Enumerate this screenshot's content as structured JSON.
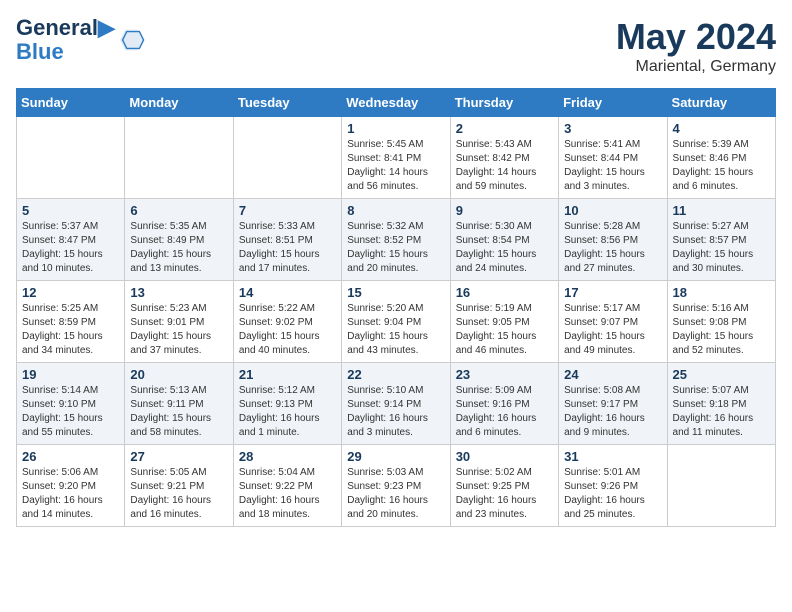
{
  "header": {
    "logo_line1": "General",
    "logo_line2": "Blue",
    "month": "May 2024",
    "location": "Mariental, Germany"
  },
  "columns": [
    "Sunday",
    "Monday",
    "Tuesday",
    "Wednesday",
    "Thursday",
    "Friday",
    "Saturday"
  ],
  "weeks": [
    [
      {
        "day": "",
        "info": ""
      },
      {
        "day": "",
        "info": ""
      },
      {
        "day": "",
        "info": ""
      },
      {
        "day": "1",
        "info": "Sunrise: 5:45 AM\nSunset: 8:41 PM\nDaylight: 14 hours and 56 minutes."
      },
      {
        "day": "2",
        "info": "Sunrise: 5:43 AM\nSunset: 8:42 PM\nDaylight: 14 hours and 59 minutes."
      },
      {
        "day": "3",
        "info": "Sunrise: 5:41 AM\nSunset: 8:44 PM\nDaylight: 15 hours and 3 minutes."
      },
      {
        "day": "4",
        "info": "Sunrise: 5:39 AM\nSunset: 8:46 PM\nDaylight: 15 hours and 6 minutes."
      }
    ],
    [
      {
        "day": "5",
        "info": "Sunrise: 5:37 AM\nSunset: 8:47 PM\nDaylight: 15 hours and 10 minutes."
      },
      {
        "day": "6",
        "info": "Sunrise: 5:35 AM\nSunset: 8:49 PM\nDaylight: 15 hours and 13 minutes."
      },
      {
        "day": "7",
        "info": "Sunrise: 5:33 AM\nSunset: 8:51 PM\nDaylight: 15 hours and 17 minutes."
      },
      {
        "day": "8",
        "info": "Sunrise: 5:32 AM\nSunset: 8:52 PM\nDaylight: 15 hours and 20 minutes."
      },
      {
        "day": "9",
        "info": "Sunrise: 5:30 AM\nSunset: 8:54 PM\nDaylight: 15 hours and 24 minutes."
      },
      {
        "day": "10",
        "info": "Sunrise: 5:28 AM\nSunset: 8:56 PM\nDaylight: 15 hours and 27 minutes."
      },
      {
        "day": "11",
        "info": "Sunrise: 5:27 AM\nSunset: 8:57 PM\nDaylight: 15 hours and 30 minutes."
      }
    ],
    [
      {
        "day": "12",
        "info": "Sunrise: 5:25 AM\nSunset: 8:59 PM\nDaylight: 15 hours and 34 minutes."
      },
      {
        "day": "13",
        "info": "Sunrise: 5:23 AM\nSunset: 9:01 PM\nDaylight: 15 hours and 37 minutes."
      },
      {
        "day": "14",
        "info": "Sunrise: 5:22 AM\nSunset: 9:02 PM\nDaylight: 15 hours and 40 minutes."
      },
      {
        "day": "15",
        "info": "Sunrise: 5:20 AM\nSunset: 9:04 PM\nDaylight: 15 hours and 43 minutes."
      },
      {
        "day": "16",
        "info": "Sunrise: 5:19 AM\nSunset: 9:05 PM\nDaylight: 15 hours and 46 minutes."
      },
      {
        "day": "17",
        "info": "Sunrise: 5:17 AM\nSunset: 9:07 PM\nDaylight: 15 hours and 49 minutes."
      },
      {
        "day": "18",
        "info": "Sunrise: 5:16 AM\nSunset: 9:08 PM\nDaylight: 15 hours and 52 minutes."
      }
    ],
    [
      {
        "day": "19",
        "info": "Sunrise: 5:14 AM\nSunset: 9:10 PM\nDaylight: 15 hours and 55 minutes."
      },
      {
        "day": "20",
        "info": "Sunrise: 5:13 AM\nSunset: 9:11 PM\nDaylight: 15 hours and 58 minutes."
      },
      {
        "day": "21",
        "info": "Sunrise: 5:12 AM\nSunset: 9:13 PM\nDaylight: 16 hours and 1 minute."
      },
      {
        "day": "22",
        "info": "Sunrise: 5:10 AM\nSunset: 9:14 PM\nDaylight: 16 hours and 3 minutes."
      },
      {
        "day": "23",
        "info": "Sunrise: 5:09 AM\nSunset: 9:16 PM\nDaylight: 16 hours and 6 minutes."
      },
      {
        "day": "24",
        "info": "Sunrise: 5:08 AM\nSunset: 9:17 PM\nDaylight: 16 hours and 9 minutes."
      },
      {
        "day": "25",
        "info": "Sunrise: 5:07 AM\nSunset: 9:18 PM\nDaylight: 16 hours and 11 minutes."
      }
    ],
    [
      {
        "day": "26",
        "info": "Sunrise: 5:06 AM\nSunset: 9:20 PM\nDaylight: 16 hours and 14 minutes."
      },
      {
        "day": "27",
        "info": "Sunrise: 5:05 AM\nSunset: 9:21 PM\nDaylight: 16 hours and 16 minutes."
      },
      {
        "day": "28",
        "info": "Sunrise: 5:04 AM\nSunset: 9:22 PM\nDaylight: 16 hours and 18 minutes."
      },
      {
        "day": "29",
        "info": "Sunrise: 5:03 AM\nSunset: 9:23 PM\nDaylight: 16 hours and 20 minutes."
      },
      {
        "day": "30",
        "info": "Sunrise: 5:02 AM\nSunset: 9:25 PM\nDaylight: 16 hours and 23 minutes."
      },
      {
        "day": "31",
        "info": "Sunrise: 5:01 AM\nSunset: 9:26 PM\nDaylight: 16 hours and 25 minutes."
      },
      {
        "day": "",
        "info": ""
      }
    ]
  ]
}
